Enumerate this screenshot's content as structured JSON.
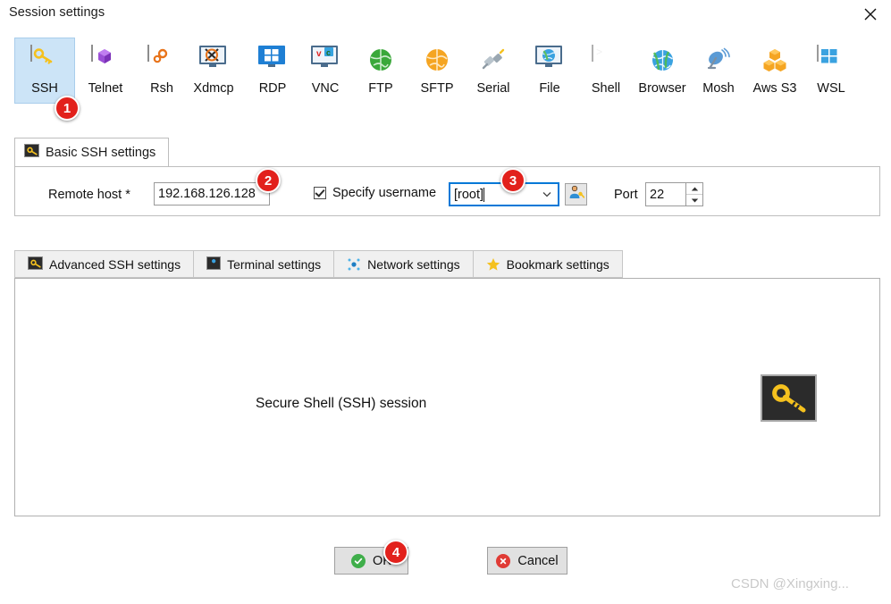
{
  "window": {
    "title": "Session settings",
    "close_icon": "close-icon"
  },
  "protocols": [
    {
      "label": "SSH",
      "icon": "ssh-key-icon",
      "selected": true
    },
    {
      "label": "Telnet",
      "icon": "telnet-cube-icon",
      "selected": false
    },
    {
      "label": "Rsh",
      "icon": "rsh-gears-icon",
      "selected": false
    },
    {
      "label": "Xdmcp",
      "icon": "xdmcp-monitor-icon",
      "selected": false
    },
    {
      "label": "RDP",
      "icon": "rdp-monitor-icon",
      "selected": false
    },
    {
      "label": "VNC",
      "icon": "vnc-monitor-icon",
      "selected": false
    },
    {
      "label": "FTP",
      "icon": "ftp-globe-icon",
      "selected": false
    },
    {
      "label": "SFTP",
      "icon": "sftp-globe-icon",
      "selected": false
    },
    {
      "label": "Serial",
      "icon": "serial-plug-icon",
      "selected": false
    },
    {
      "label": "File",
      "icon": "file-monitor-icon",
      "selected": false
    },
    {
      "label": "Shell",
      "icon": "shell-prompt-icon",
      "selected": false
    },
    {
      "label": "Browser",
      "icon": "browser-globe-icon",
      "selected": false
    },
    {
      "label": "Mosh",
      "icon": "mosh-dish-icon",
      "selected": false
    },
    {
      "label": "Aws S3",
      "icon": "aws-s3-cubes-icon",
      "selected": false
    },
    {
      "label": "WSL",
      "icon": "wsl-windows-icon",
      "selected": false
    }
  ],
  "basic": {
    "tab_label": "Basic SSH settings",
    "tab_icon": "ssh-key-icon",
    "remote_host_label": "Remote host *",
    "remote_host_value": "192.168.126.128",
    "specify_username_label": "Specify username",
    "specify_username_checked": true,
    "username_value": "[root]",
    "username_dropdown_icon": "chevron-down-icon",
    "user_picker_icon": "user-key-icon",
    "port_label": "Port",
    "port_value": "22",
    "spinner_up_icon": "spinner-up-icon",
    "spinner_down_icon": "spinner-down-icon"
  },
  "tabs": [
    {
      "label": "Advanced SSH settings",
      "icon": "ssh-key-icon"
    },
    {
      "label": "Terminal settings",
      "icon": "terminal-icon"
    },
    {
      "label": "Network settings",
      "icon": "network-nodes-icon"
    },
    {
      "label": "Bookmark settings",
      "icon": "star-icon"
    }
  ],
  "content": {
    "description": "Secure Shell (SSH) session",
    "session_icon": "ssh-key-large-icon"
  },
  "footer": {
    "ok_label": "OK",
    "ok_icon": "check-circle-icon",
    "cancel_label": "Cancel",
    "cancel_icon": "x-circle-icon"
  },
  "callouts": [
    {
      "number": "1"
    },
    {
      "number": "2"
    },
    {
      "number": "3"
    },
    {
      "number": "4"
    }
  ],
  "watermark": "CSDN @Xingxing...",
  "colors": {
    "selection_blue": "#cce4f7",
    "focus_blue": "#0078d7",
    "badge_red": "#e2211c",
    "key_yellow": "#f5c11e",
    "ok_green": "#3fae4a",
    "cancel_red": "#e03b35"
  }
}
